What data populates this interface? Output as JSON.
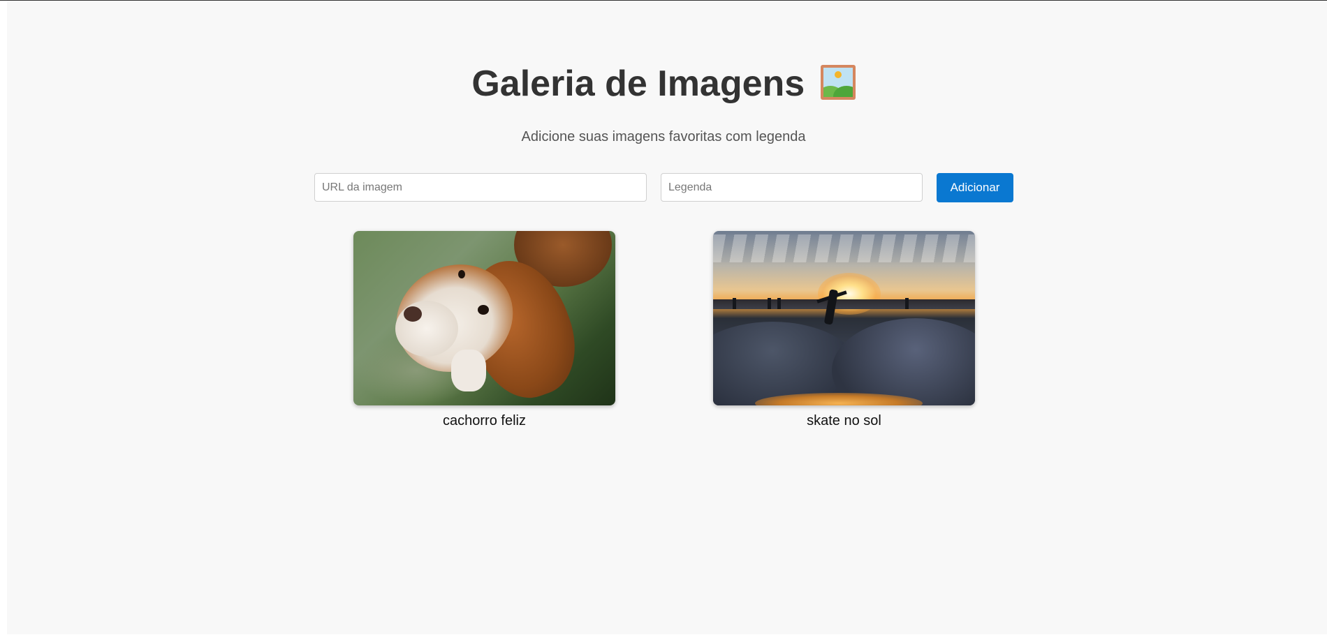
{
  "page": {
    "title": "Galeria de Imagens",
    "title_emoji": "framed-picture-icon",
    "subtitle": "Adicione suas imagens favoritas com legenda"
  },
  "form": {
    "url_placeholder": "URL da imagem",
    "url_value": "",
    "caption_placeholder": "Legenda",
    "caption_value": "",
    "add_label": "Adicionar"
  },
  "gallery": [
    {
      "image": "photo-dog",
      "caption": "cachorro feliz"
    },
    {
      "image": "photo-skate",
      "caption": "skate no sol"
    }
  ],
  "colors": {
    "accent": "#0a78d1",
    "background": "#f8f8f8",
    "title": "#333333",
    "subtitle": "#555555"
  }
}
